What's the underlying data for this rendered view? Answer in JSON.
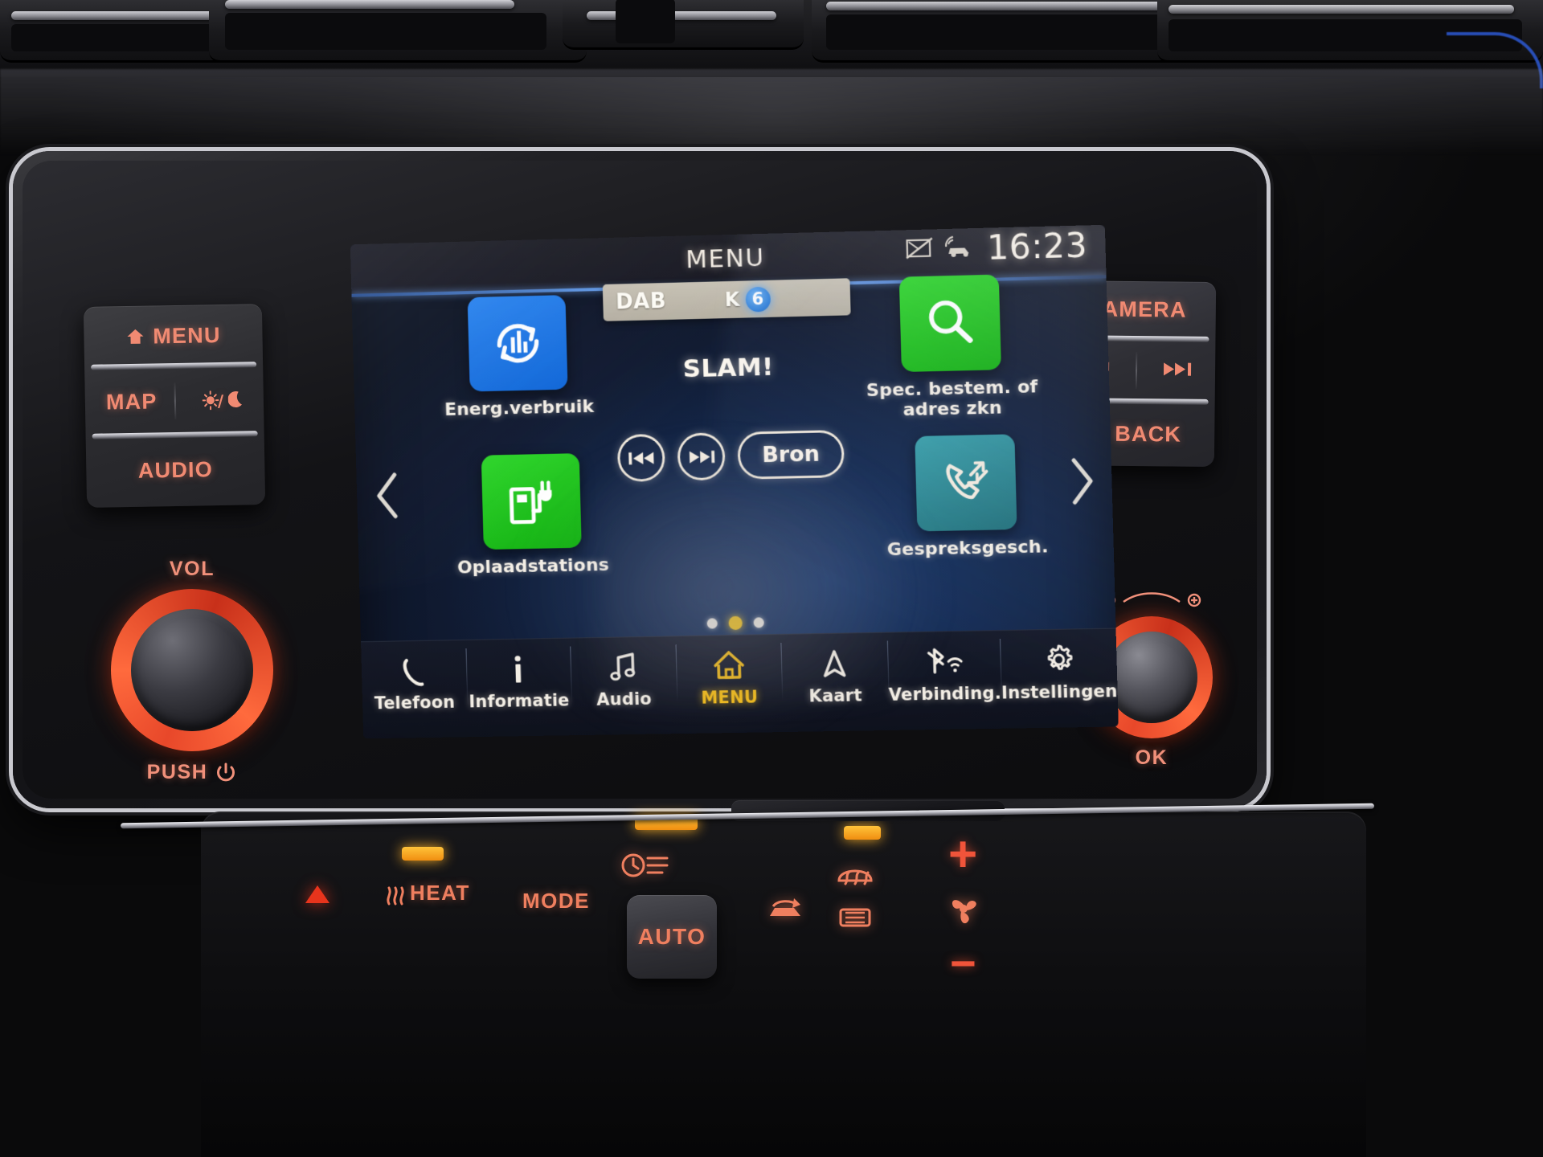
{
  "statusbar": {
    "title": "MENU",
    "clock": "16:23",
    "icons": [
      "no-message-icon",
      "car-connected-icon"
    ]
  },
  "radio": {
    "band": "DAB",
    "preset_letter": "K",
    "preset_number": "6",
    "station": "SLAM!",
    "prev_label": "prev-track-icon",
    "next_label": "next-track-icon",
    "source_button": "Bron"
  },
  "tiles": [
    {
      "id": "energy",
      "label": "Energ.verbruik",
      "color": "#1573e6",
      "icon": "energy-consumption-icon"
    },
    {
      "id": "charge",
      "label": "Oplaadstations",
      "color": "#21c21f",
      "icon": "charging-station-icon"
    },
    {
      "id": "search",
      "label": "Spec. bestem. of adres zkn",
      "color": "#21c21f",
      "icon": "search-icon"
    },
    {
      "id": "calls",
      "label": "Gespreksgesch.",
      "color": "#2f8a94",
      "icon": "call-history-icon"
    }
  ],
  "carousel": {
    "prev": "chevron-left-icon",
    "next": "chevron-right-icon",
    "pages": 3,
    "active_page": 2
  },
  "navbar": [
    {
      "id": "telefoon",
      "label": "Telefoon",
      "icon": "phone-icon",
      "active": false
    },
    {
      "id": "informatie",
      "label": "Informatie",
      "icon": "info-icon",
      "active": false
    },
    {
      "id": "audio",
      "label": "Audio",
      "icon": "music-note-icon",
      "active": false
    },
    {
      "id": "menu",
      "label": "MENU",
      "icon": "home-icon",
      "active": true
    },
    {
      "id": "kaart",
      "label": "Kaart",
      "icon": "navigation-arrow-icon",
      "active": false
    },
    {
      "id": "verbinding",
      "label": "Verbinding.",
      "icon": "bluetooth-wifi-icon",
      "active": false
    },
    {
      "id": "instellingen",
      "label": "Instellingen",
      "icon": "gear-icon",
      "active": false
    }
  ],
  "hardware": {
    "left_keys": {
      "menu": "MENU",
      "map": "MAP",
      "daynight": "day-night-icon",
      "audio": "AUDIO"
    },
    "right_keys": {
      "camera": "CAMERA",
      "prev": "prev-track-icon",
      "next": "next-track-icon",
      "back": "BACK"
    },
    "volume_knob": {
      "top_label": "VOL",
      "bottom_label": "PUSH",
      "power_icon": "power-icon"
    },
    "ok_knob": {
      "label": "OK",
      "zoom_icons": "zoom-out-in-icon"
    }
  },
  "climate": {
    "mode": "MODE",
    "auto": "AUTO",
    "heat": "HEAT",
    "rear_defrost_icon": "rear-defrost-icon",
    "front_defrost_icon": "front-defrost-icon",
    "recirculate_icon": "air-recirculate-icon",
    "fan_icon": "fan-icon",
    "timer_icon": "climate-timer-icon",
    "plus": "+",
    "minus": "−",
    "up_arrow_icon": "temp-up-icon"
  },
  "colors": {
    "tile_blue": "#1573e6",
    "tile_green": "#21c21f",
    "tile_teal": "#2f8a94",
    "accent_amber": "#f5bd18",
    "preset_blue": "#2f7fd8",
    "hard_key_red": "#f08a72",
    "knob_red": "#e8482a"
  }
}
